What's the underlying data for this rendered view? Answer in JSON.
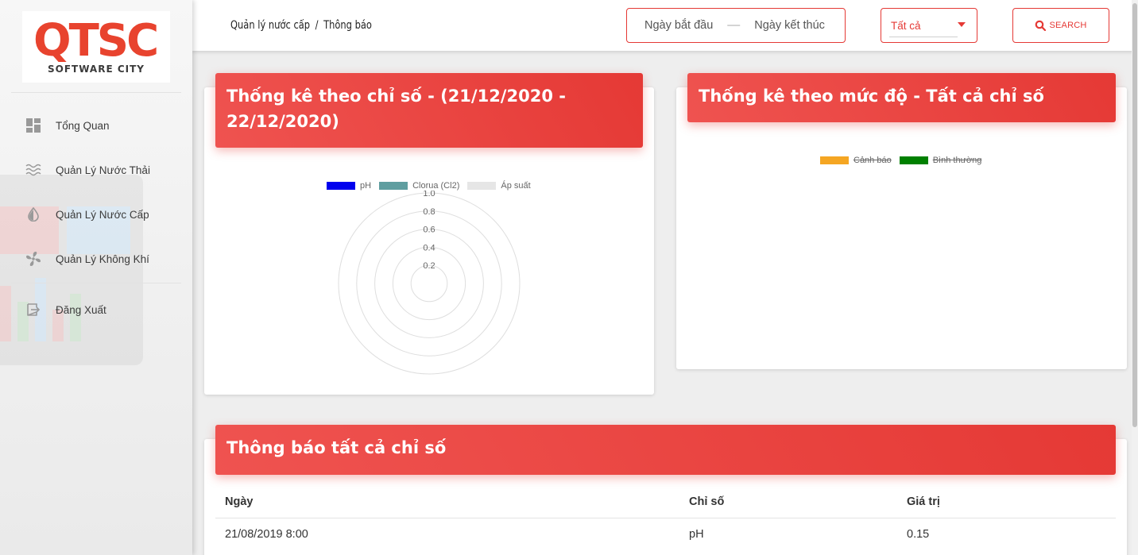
{
  "brand": {
    "logo_text": "QTSC",
    "logo_subtitle": "SOFTWARE CITY"
  },
  "sidebar": {
    "items": [
      {
        "label": "Tổng Quan",
        "icon": "dashboard-icon"
      },
      {
        "label": "Quản Lý Nước Thải",
        "icon": "waves-icon"
      },
      {
        "label": "Quản Lý Nước Cấp",
        "icon": "water-drop-icon"
      },
      {
        "label": "Quản Lý Không Khí",
        "icon": "fan-icon"
      },
      {
        "label": "Đăng Xuất",
        "icon": "logout-icon"
      }
    ]
  },
  "header": {
    "breadcrumb": [
      "Quản lý nước cấp",
      "Thông báo"
    ],
    "breadcrumb_separator": "/",
    "date_start_placeholder": "Ngày bắt đầu",
    "date_separator": "—",
    "date_end_placeholder": "Ngày kết thúc",
    "filter_value": "Tất cả",
    "search_label": "SEARCH"
  },
  "radar_card": {
    "title": "Thống kê theo chỉ số - (21/12/2020 - 22/12/2020)"
  },
  "level_card": {
    "title": "Thống kê theo mức độ - Tất cả chỉ số"
  },
  "chart_data": [
    {
      "type": "radar",
      "title": "Thống kê theo chỉ số - (21/12/2020 - 22/12/2020)",
      "series": [
        {
          "name": "pH",
          "color": "#0000ee",
          "values": []
        },
        {
          "name": "Clorua (Cl2)",
          "color": "#5f9ea0",
          "values": []
        },
        {
          "name": "Áp suất",
          "color": "#e6e6e6",
          "values": []
        }
      ],
      "radial_ticks": [
        "1.0",
        "0.8",
        "0.6",
        "0.4",
        "0.2"
      ],
      "rlim": [
        0,
        1.0
      ],
      "legend": "top"
    },
    {
      "type": "pie",
      "title": "Thống kê theo mức độ - Tất cả chỉ số",
      "series": [
        {
          "name": "Cảnh báo",
          "color": "#f5a623",
          "hidden": true
        },
        {
          "name": "Bình thường",
          "color": "#008000",
          "hidden": true
        }
      ],
      "legend": "top"
    }
  ],
  "notice_table": {
    "title": "Thông báo tất cả chỉ số",
    "columns": [
      "Ngày",
      "Chỉ số",
      "Giá trị"
    ],
    "rows": [
      [
        "21/08/2019 8:00",
        "pH",
        "0.15"
      ]
    ]
  },
  "colors": {
    "accent": "#e53935",
    "accent_light": "#ef5350"
  }
}
